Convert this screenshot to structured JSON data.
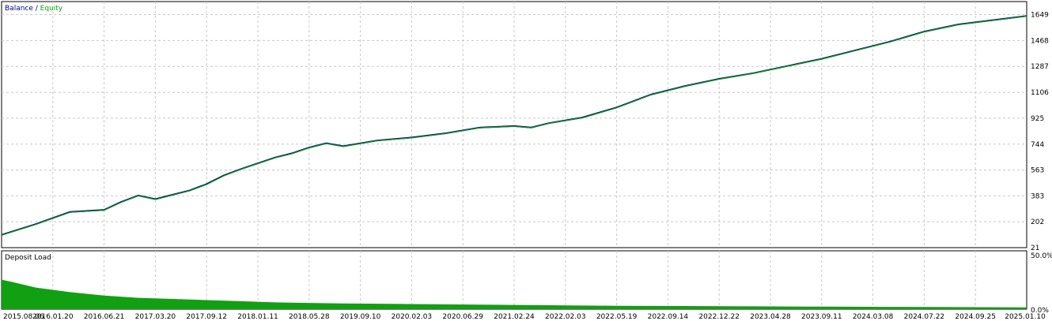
{
  "chart_data": [
    {
      "type": "line",
      "title": "",
      "legend": [
        {
          "label": "Balance",
          "color": "#00008b"
        },
        {
          "label": "Equity",
          "color": "#11a011"
        }
      ],
      "legend_separator": " / ",
      "legend_placement": "top-left",
      "ylim": [
        21,
        1740
      ],
      "yticks": [
        21,
        202,
        383,
        563,
        744,
        925,
        1106,
        1287,
        1468,
        1649
      ],
      "xticks": [
        "2015.08.06",
        "2016.01.20",
        "2016.06.21",
        "2017.03.20",
        "2017.09.12",
        "2018.01.11",
        "2018.05.28",
        "2019.09.10",
        "2020.02.03",
        "2020.06.29",
        "2021.02.24",
        "2022.02.03",
        "2022.05.19",
        "2022.09.14",
        "2022.12.22",
        "2023.04.28",
        "2023.09.11",
        "2024.03.08",
        "2024.07.22",
        "2024.09.25",
        "2025.01.10"
      ],
      "grid": true,
      "series": [
        {
          "name": "Balance",
          "color": "#00008b",
          "x": [
            0,
            1,
            2,
            3,
            3.5,
            4,
            4.5,
            5,
            5.5,
            6,
            6.5,
            7,
            7.5,
            8,
            8.5,
            9,
            9.5,
            10,
            11,
            12,
            13,
            14,
            15,
            15.5,
            16,
            17,
            18,
            19,
            20
          ],
          "y": [
            110,
            185,
            270,
            285,
            340,
            385,
            360,
            390,
            420,
            465,
            525,
            570,
            610,
            650,
            680,
            720,
            750,
            730,
            770,
            790,
            820,
            860,
            870,
            860,
            890,
            930,
            1000,
            1090,
            1150
          ]
        },
        {
          "name": "Equity",
          "color": "#11a011",
          "x": [
            0,
            1,
            2,
            3,
            3.5,
            4,
            4.5,
            5,
            5.5,
            6,
            6.5,
            7,
            7.5,
            8,
            8.5,
            9,
            9.5,
            10,
            11,
            12,
            13,
            14,
            15,
            15.5,
            16,
            17,
            18,
            19,
            20
          ],
          "y": [
            108,
            183,
            268,
            282,
            338,
            383,
            357,
            388,
            418,
            462,
            522,
            568,
            608,
            648,
            678,
            718,
            748,
            727,
            768,
            788,
            818,
            858,
            868,
            858,
            888,
            928,
            998,
            1088,
            1148
          ]
        }
      ],
      "x_extended": [
        21,
        22,
        23,
        24,
        25,
        26,
        27,
        28,
        29,
        30
      ],
      "y_extended": [
        1200,
        1240,
        1290,
        1340,
        1400,
        1460,
        1530,
        1580,
        1610,
        1640
      ]
    },
    {
      "type": "area",
      "title": "Deposit Load",
      "ylim": [
        0,
        50
      ],
      "yticks_labels": [
        "0.0%",
        "50.0%"
      ],
      "color": "#11a011",
      "x": [
        0,
        0.3,
        1,
        2,
        3,
        4,
        5,
        6,
        7,
        8,
        9,
        10,
        12,
        14,
        16,
        18,
        20,
        22,
        24,
        26,
        28,
        30
      ],
      "values": [
        26,
        24,
        19,
        15,
        12,
        10,
        9,
        8,
        7,
        6,
        5.5,
        5,
        4.5,
        4,
        3.5,
        3,
        2.8,
        2.5,
        2.2,
        2,
        1.8,
        1.6
      ]
    }
  ]
}
